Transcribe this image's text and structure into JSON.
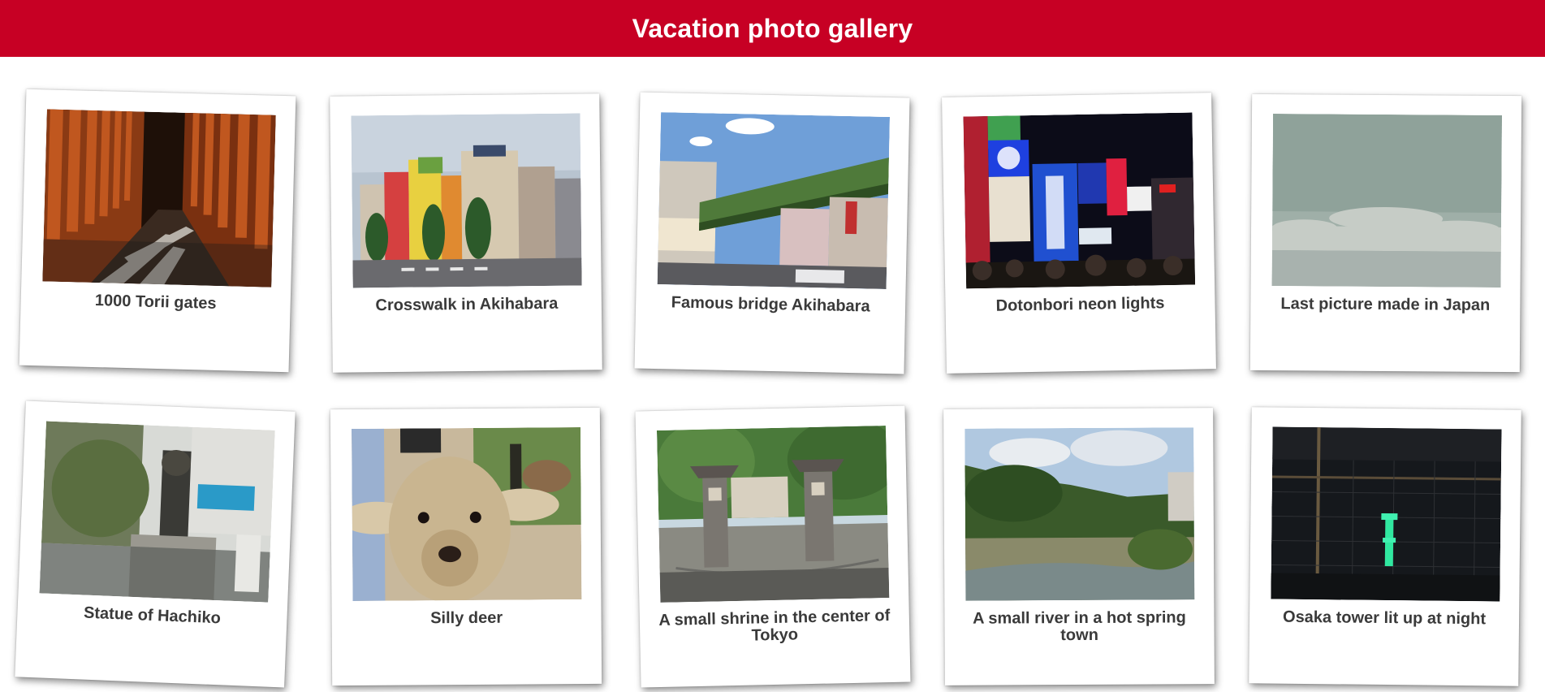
{
  "header": {
    "title": "Vacation photo gallery",
    "background": "#c70024"
  },
  "gallery": {
    "items": [
      {
        "caption": "1000 Torii gates",
        "photo": "torii-gates-photo"
      },
      {
        "caption": "Crosswalk in Akihabara",
        "photo": "akihabara-crosswalk-photo"
      },
      {
        "caption": "Famous bridge Akihabara",
        "photo": "akihabara-bridge-photo"
      },
      {
        "caption": "Dotonbori neon lights",
        "photo": "dotonbori-neon-photo"
      },
      {
        "caption": "Last picture made in Japan",
        "photo": "clouds-sea-photo"
      },
      {
        "caption": "Statue of Hachiko",
        "photo": "hachiko-statue-photo"
      },
      {
        "caption": "Silly deer",
        "photo": "deer-photo"
      },
      {
        "caption": "A small shrine in the center of Tokyo",
        "photo": "shrine-photo"
      },
      {
        "caption": "A small river in a hot spring town",
        "photo": "river-photo"
      },
      {
        "caption": "Osaka tower lit up at night",
        "photo": "osaka-tower-photo"
      }
    ]
  }
}
